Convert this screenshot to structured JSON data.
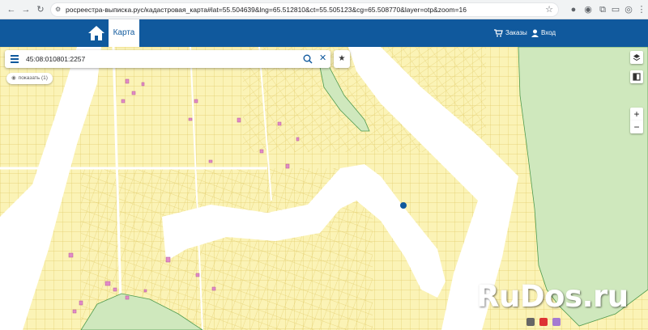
{
  "browser": {
    "url": "росреестра-выписка.рус/кадастровая_карта#lat=55.504639&lng=65.512810&ct=55.505123&cg=65.508770&layer=otp&zoom=16",
    "back_icon": "arrow-left-icon",
    "forward_icon": "arrow-right-icon",
    "reload_icon": "reload-icon"
  },
  "header": {
    "brand_color": "#10599d",
    "home_icon": "home-icon",
    "tab_map_label": "Карта",
    "orders_label": "Заказы",
    "login_label": "Вход"
  },
  "search": {
    "value": "45:08:010801:2257"
  },
  "map": {
    "show_button_label": "показать (1)",
    "parcel_color": "#fbf3b6",
    "forest_color": "#cfe8bd",
    "marker_color": "#10599d"
  },
  "controls": {
    "zoom_in": "+",
    "zoom_out": "−",
    "favorite": "★"
  },
  "watermark": {
    "text": "RuDos.ru"
  }
}
